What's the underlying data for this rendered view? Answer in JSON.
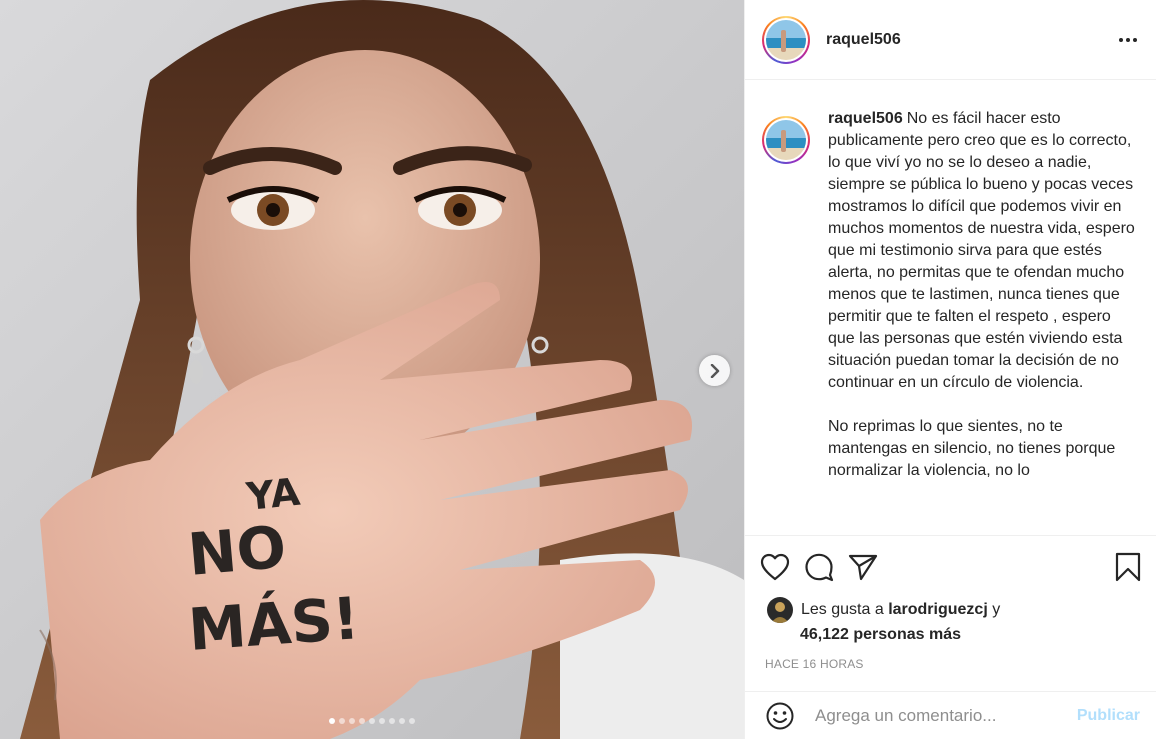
{
  "post": {
    "username": "raquel506",
    "caption_paragraphs": [
      "No es fácil hacer esto publicamente pero creo que es lo correcto, lo que viví yo no se lo deseo a nadie, siempre se pública lo bueno y pocas veces mostramos lo difícil que podemos vivir en muchos momentos de nuestra vida, espero que mi testimonio sirva para que estés alerta, no permitas que te ofendan mucho menos que te lastimen, nunca tienes que permitir que te falten el respeto , espero que las personas que estén viviendo esta situación puedan tomar la decisión de no continuar en un círculo de violencia.",
      "No reprimas lo que sientes, no te mantengas en silencio, no tienes porque normalizar la violencia, no lo"
    ],
    "hand_text": [
      "YA",
      "NO",
      "MÁS!"
    ],
    "carousel": {
      "total": 9,
      "active": 1
    },
    "likes": {
      "prefix": "Les gusta a",
      "liker": "larodriguezcj",
      "conjunction": "y",
      "others": "46,122 personas más"
    },
    "timestamp": "HACE 16 HORAS",
    "comment_placeholder": "Agrega un comentario...",
    "publish_label": "Publicar"
  },
  "icons": {
    "more": "more-dots-icon",
    "like": "heart-icon",
    "comment": "comment-bubble-icon",
    "share": "paper-plane-icon",
    "save": "bookmark-icon",
    "emoji": "smiley-icon",
    "next": "chevron-right-icon"
  },
  "colors": {
    "text": "#262626",
    "muted": "#8e8e8e",
    "publish_disabled": "#b2dffc",
    "border": "#efefef"
  }
}
